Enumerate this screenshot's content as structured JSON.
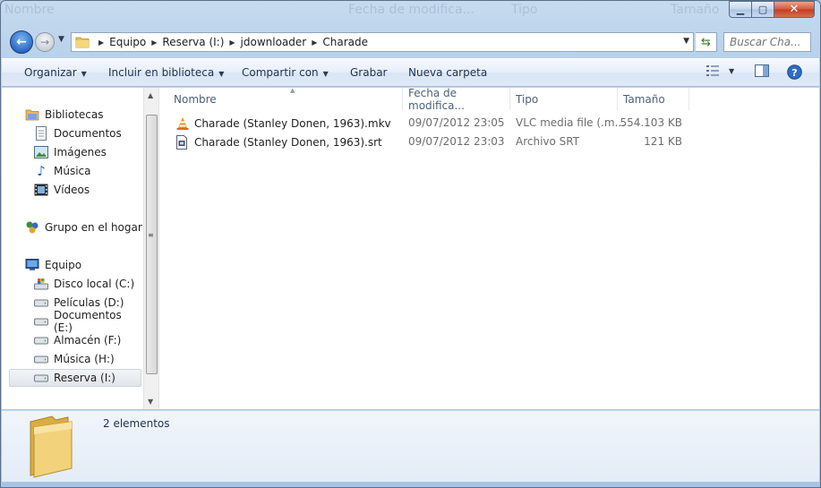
{
  "window": {
    "ghost_caption": [
      "Nombre",
      "Fecha de modifica...",
      "Tipo",
      "Tamaño"
    ]
  },
  "address": {
    "breadcrumbs": [
      "Equipo",
      "Reserva (I:)",
      "jdownloader",
      "Charade"
    ]
  },
  "search": {
    "placeholder": "Buscar Cha..."
  },
  "toolbar": {
    "organize": "Organizar",
    "include_library": "Incluir en biblioteca",
    "share_with": "Compartir con",
    "burn": "Grabar",
    "new_folder": "Nueva carpeta"
  },
  "nav": {
    "libraries": "Bibliotecas",
    "library_items": [
      "Documentos",
      "Imágenes",
      "Música",
      "Vídeos"
    ],
    "homegroup": "Grupo en el hogar",
    "computer": "Equipo",
    "drives": [
      "Disco local (C:)",
      "Películas (D:)",
      "Documentos (E:)",
      "Almacén (F:)",
      "Música (H:)",
      "Reserva (I:)"
    ],
    "selected": "Reserva (I:)"
  },
  "columns": {
    "name": "Nombre",
    "date": "Fecha de modifica...",
    "type": "Tipo",
    "size": "Tamaño"
  },
  "files": [
    {
      "name": "Charade (Stanley Donen, 1963).mkv",
      "date": "09/07/2012 23:05",
      "type": "VLC media file (.m...",
      "size": "554.103 KB",
      "icon": "vlc-cone-icon"
    },
    {
      "name": "Charade (Stanley Donen, 1963).srt",
      "date": "09/07/2012 23:03",
      "type": "Archivo SRT",
      "size": "121 KB",
      "icon": "srt-file-icon"
    }
  ],
  "details": {
    "count": "2 elementos"
  },
  "colors": {
    "accent": "#2a6ac9",
    "close": "#c43b1f"
  }
}
